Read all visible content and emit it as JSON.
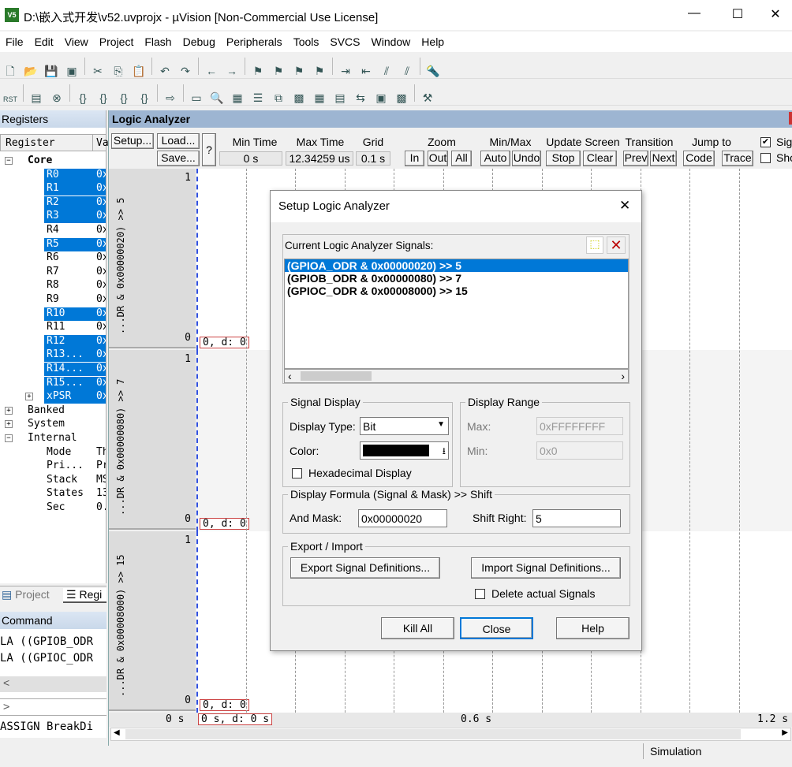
{
  "window": {
    "title": "D:\\嵌入式开发\\v52.uvprojx - µVision  [Non-Commercial Use License]",
    "app_icon": "V5",
    "min": "—",
    "max": "☐",
    "close": "✕"
  },
  "menu": [
    "File",
    "Edit",
    "View",
    "Project",
    "Flash",
    "Debug",
    "Peripherals",
    "Tools",
    "SVCS",
    "Window",
    "Help"
  ],
  "registers": {
    "title": "Registers",
    "col_register": "Register",
    "col_value": "Va",
    "rows": [
      {
        "label": "Core",
        "value": "",
        "level": 0,
        "exp": "−",
        "bold": true,
        "sel": false
      },
      {
        "label": "R0",
        "value": "0x",
        "level": 1,
        "sel": true
      },
      {
        "label": "R1",
        "value": "0x",
        "level": 1,
        "sel": true
      },
      {
        "label": "R2",
        "value": "0x",
        "level": 1,
        "sel": true
      },
      {
        "label": "R3",
        "value": "0x",
        "level": 1,
        "sel": true
      },
      {
        "label": "R4",
        "value": "0x",
        "level": 1,
        "sel": false
      },
      {
        "label": "R5",
        "value": "0x",
        "level": 1,
        "sel": true
      },
      {
        "label": "R6",
        "value": "0x",
        "level": 1,
        "sel": false
      },
      {
        "label": "R7",
        "value": "0x",
        "level": 1,
        "sel": false
      },
      {
        "label": "R8",
        "value": "0x",
        "level": 1,
        "sel": false
      },
      {
        "label": "R9",
        "value": "0x",
        "level": 1,
        "sel": false
      },
      {
        "label": "R10",
        "value": "0x",
        "level": 1,
        "sel": true
      },
      {
        "label": "R11",
        "value": "0x",
        "level": 1,
        "sel": false
      },
      {
        "label": "R12",
        "value": "0x",
        "level": 1,
        "sel": true
      },
      {
        "label": "R13...",
        "value": "0x",
        "level": 1,
        "sel": true
      },
      {
        "label": "R14...",
        "value": "0x",
        "level": 1,
        "sel": true
      },
      {
        "label": "R15...",
        "value": "0x",
        "level": 1,
        "sel": true
      },
      {
        "label": "xPSR",
        "value": "0x",
        "level": 1,
        "exp": "+",
        "sel": true
      },
      {
        "label": "Banked",
        "value": "",
        "level": 0,
        "exp": "+",
        "sel": false
      },
      {
        "label": "System",
        "value": "",
        "level": 0,
        "exp": "+",
        "sel": false
      },
      {
        "label": "Internal",
        "value": "",
        "level": 0,
        "exp": "−",
        "sel": false
      },
      {
        "label": "Mode",
        "value": "Th",
        "level": 1,
        "sel": false
      },
      {
        "label": "Pri...",
        "value": "Pr",
        "level": 1,
        "sel": false
      },
      {
        "label": "Stack",
        "value": "MS",
        "level": 1,
        "sel": false
      },
      {
        "label": "States",
        "value": "13",
        "level": 1,
        "sel": false
      },
      {
        "label": "Sec",
        "value": "0.",
        "level": 1,
        "sel": false
      }
    ]
  },
  "tabs": {
    "project": "Project",
    "registers": "Regi"
  },
  "command": {
    "title": "Command",
    "lines": [
      "LA ((GPIOB_ODR",
      "LA ((GPIOC_ODR"
    ],
    "prompt": ">",
    "status": "ASSIGN BreakDi"
  },
  "la": {
    "title": "Logic Analyzer",
    "setup": "Setup...",
    "load": "Load...",
    "save": "Save...",
    "help": "?",
    "min_time_label": "Min Time",
    "min_time": "0 s",
    "max_time_label": "Max Time",
    "max_time": "12.34259 us",
    "grid_label": "Grid",
    "grid": "0.1 s",
    "zoom_label": "Zoom",
    "zoom_in": "In",
    "zoom_out": "Out",
    "zoom_all": "All",
    "minmax_label": "Min/Max",
    "auto": "Auto",
    "undo": "Undo",
    "update_label": "Update Screen",
    "stop": "Stop",
    "clear": "Clear",
    "transition_label": "Transition",
    "prev": "Prev",
    "next": "Next",
    "jump_label": "Jump to",
    "code": "Code",
    "trace": "Trace",
    "chk1": "Sig",
    "chk1_checked": true,
    "chk2": "Sho",
    "chk2_checked": false,
    "signals": [
      {
        "name": "...DR & 0x00000020) >> 5",
        "max": "1",
        "min": "0",
        "cursor": "0,   d: 0"
      },
      {
        "name": "...DR & 0x00000080) >> 7",
        "max": "1",
        "min": "0",
        "cursor": "0,   d: 0"
      },
      {
        "name": "...DR & 0x00008000) >> 15",
        "max": "1",
        "min": "0",
        "cursor": "0,   d: 0"
      }
    ],
    "axis": {
      "t0": "0 s",
      "t1": "0.6 s",
      "t2": "1.2 s",
      "cursor": "0 s,   d: 0 s"
    },
    "status": "Simulation"
  },
  "dialog": {
    "title": "Setup Logic Analyzer",
    "close": "✕",
    "signals_label": "Current Logic Analyzer Signals:",
    "signals": [
      "(GPIOA_ODR & 0x00000020) >> 5",
      "(GPIOB_ODR & 0x00000080) >> 7",
      "(GPIOC_ODR & 0x00008000) >> 15"
    ],
    "selected_index": 0,
    "signal_display": "Signal Display",
    "display_type_label": "Display Type:",
    "display_type": "Bit",
    "color_label": "Color:",
    "color": "#000000",
    "hex_label": "Hexadecimal Display",
    "hex_checked": false,
    "display_range": "Display Range",
    "max_label": "Max:",
    "max": "0xFFFFFFFF",
    "min_label": "Min:",
    "min": "0x0",
    "formula": "Display Formula (Signal & Mask) >> Shift",
    "and_mask_label": "And Mask:",
    "and_mask": "0x00000020",
    "shift_label": "Shift Right:",
    "shift": "5",
    "export_import": "Export / Import",
    "export": "Export Signal Definitions...",
    "import": "Import Signal Definitions...",
    "delete_label": "Delete actual Signals",
    "delete_checked": false,
    "kill_all": "Kill All",
    "close_btn": "Close",
    "help": "Help"
  }
}
